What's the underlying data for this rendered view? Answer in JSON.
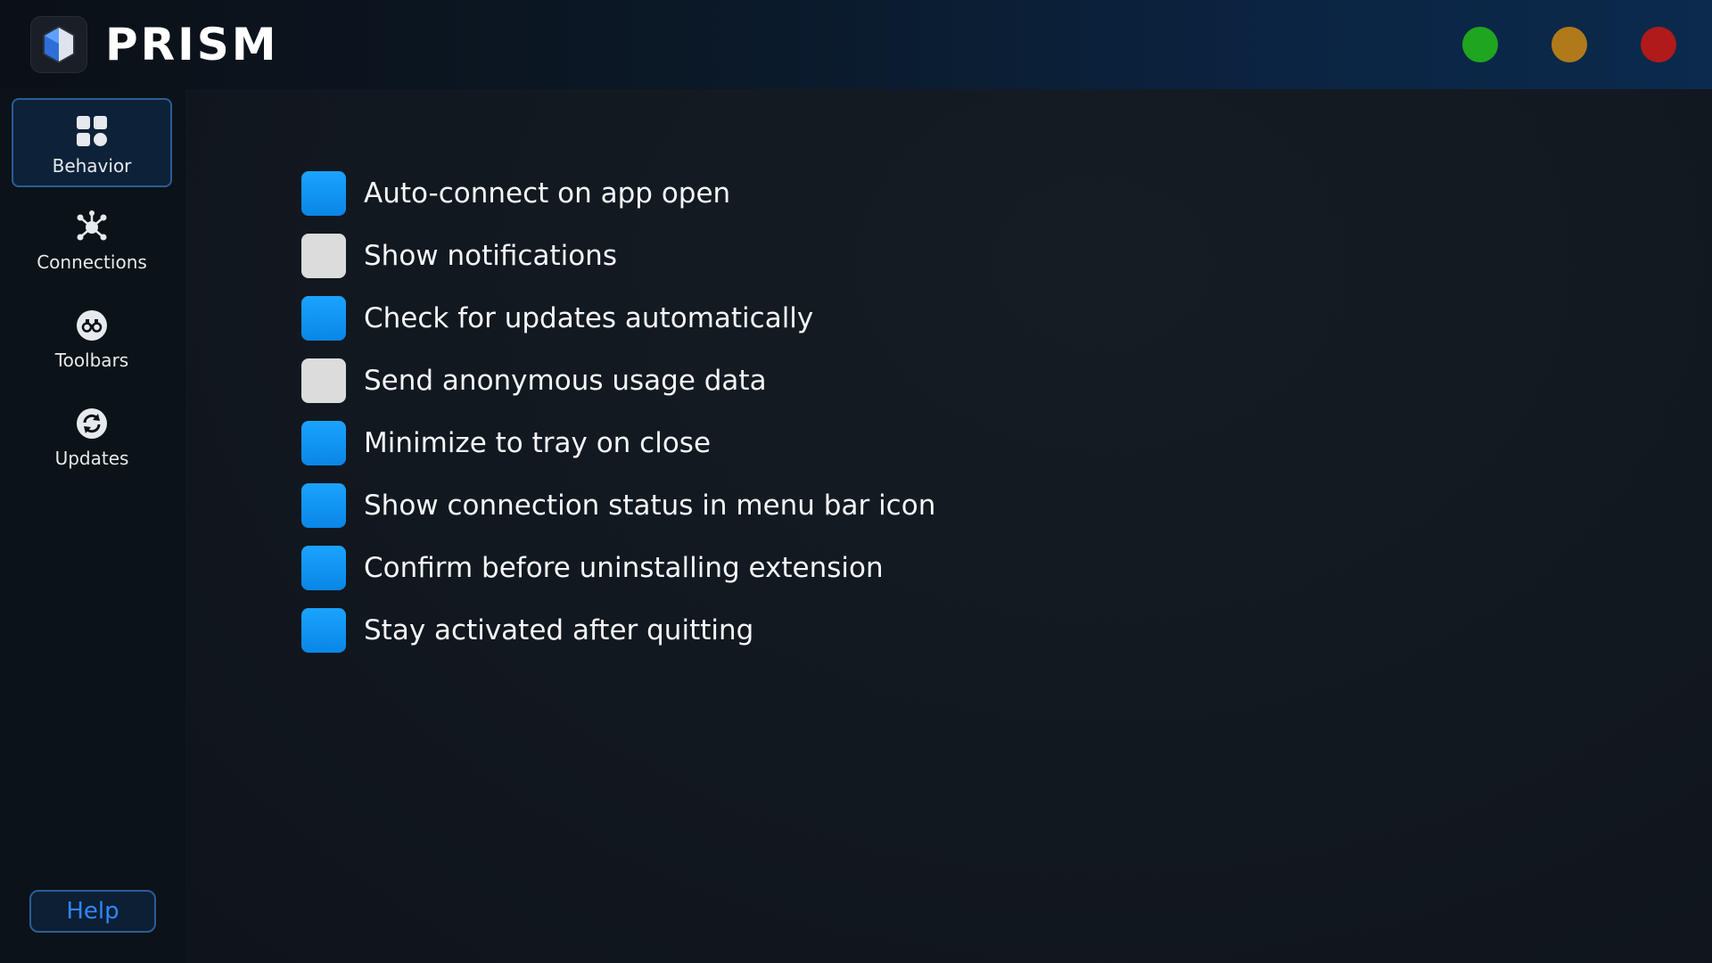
{
  "app": {
    "title": "PRISM",
    "logo_icon": "prism-logo-icon"
  },
  "window_controls": {
    "colors": {
      "green": "#1fa51f",
      "amber": "#b07a1b",
      "red": "#b01a1a"
    }
  },
  "sidebar": {
    "items": [
      {
        "label": "Behavior",
        "icon": "grid-icon",
        "active": true
      },
      {
        "label": "Connections",
        "icon": "network-icon",
        "active": false
      },
      {
        "label": "Toolbars",
        "icon": "binoculars-icon",
        "active": false
      },
      {
        "label": "Updates",
        "icon": "refresh-icon",
        "active": false
      }
    ],
    "help_label": "Help"
  },
  "settings": [
    {
      "label": "Auto-connect on app open",
      "checked": true
    },
    {
      "label": "Show notifications",
      "checked": false
    },
    {
      "label": "Check for updates automatically",
      "checked": true
    },
    {
      "label": "Send anonymous usage data",
      "checked": false
    },
    {
      "label": "Minimize to tray on close",
      "checked": true
    },
    {
      "label": "Show connection status in menu bar icon",
      "checked": true
    },
    {
      "label": "Confirm before uninstalling extension",
      "checked": true
    },
    {
      "label": "Stay activated after quitting",
      "checked": true
    }
  ],
  "colors": {
    "accent": "#1a9bf5",
    "unchecked": "#dcdcdc",
    "active_border": "#2a5d98"
  }
}
